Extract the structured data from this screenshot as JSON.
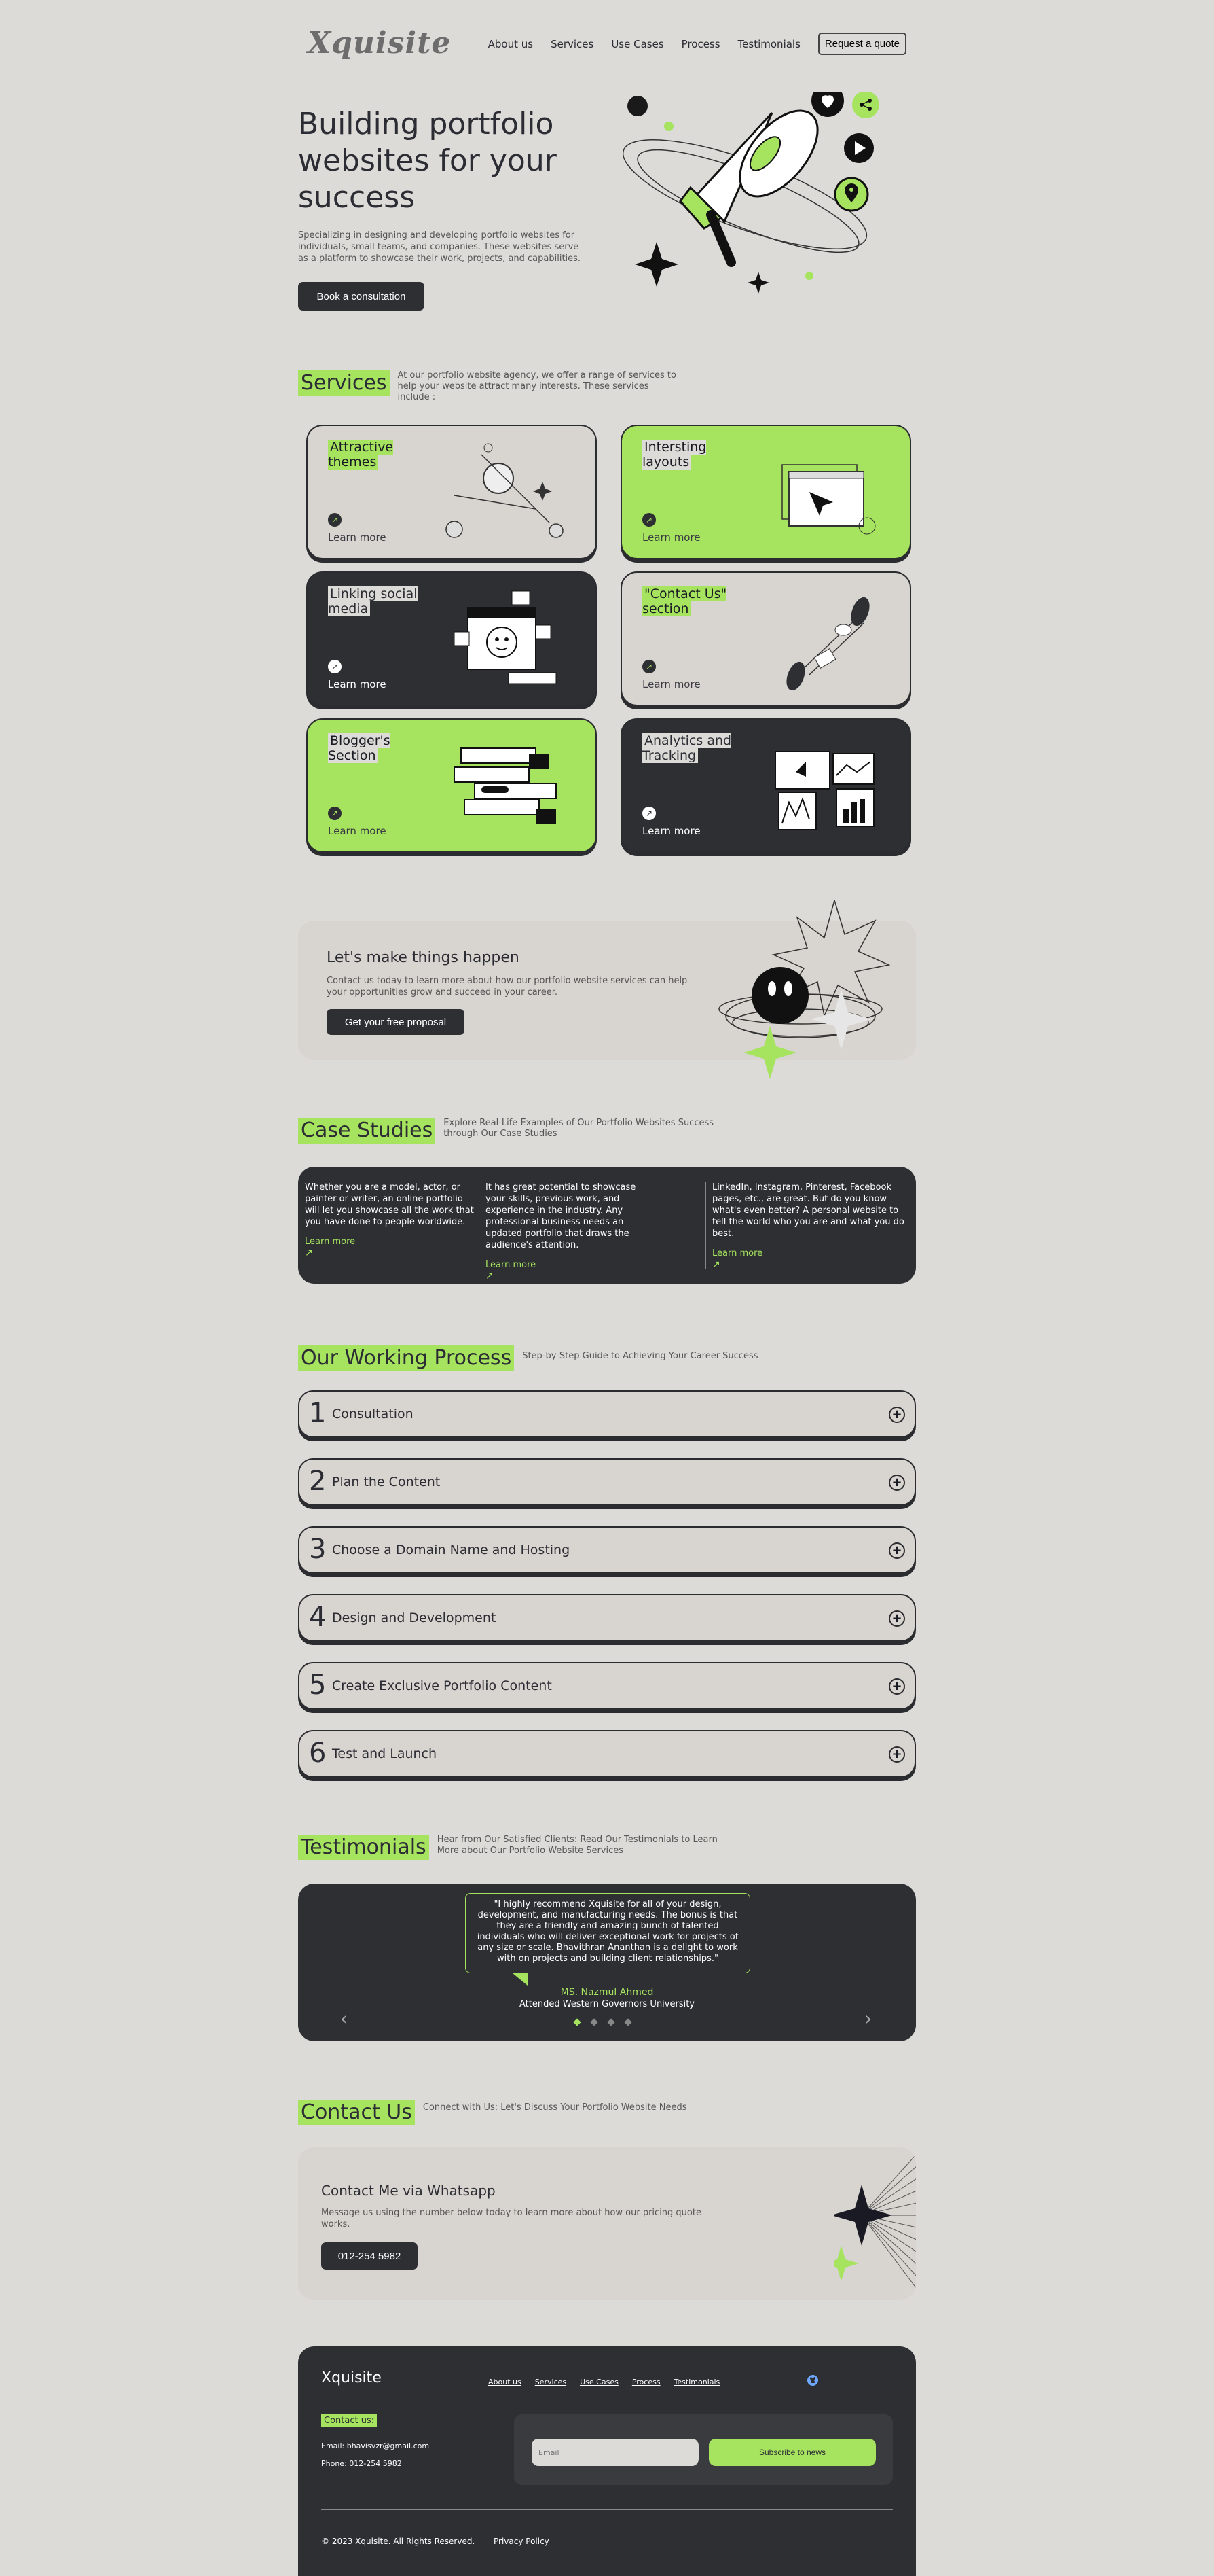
{
  "nav": {
    "logo": "Xquisite",
    "links": [
      "About us",
      "Services",
      "Use Cases",
      "Process",
      "Testimonials"
    ],
    "quote_button": "Request a quote"
  },
  "hero": {
    "title": "Building portfolio websites for your success",
    "description": "Specializing in designing and developing portfolio websites for individuals, small teams, and companies. These websites serve as a platform to showcase their work, projects, and capabilities.",
    "button": "Book a consultation"
  },
  "services": {
    "title": "Services",
    "subtitle": "At our portfolio website agency, we offer a range of services to help your website attract many interests. These services include :",
    "cards": [
      {
        "title": "Attractive themes",
        "link": "Learn more"
      },
      {
        "title": "Intersting layouts",
        "link": "Learn more"
      },
      {
        "title": "Linking social media",
        "link": "Learn more"
      },
      {
        "title": "\"Contact Us\" section",
        "link": "Learn more"
      },
      {
        "title": "Blogger's Section",
        "link": "Learn more"
      },
      {
        "title": "Analytics and Tracking",
        "link": "Learn more"
      }
    ]
  },
  "cta": {
    "title": "Let's make things happen",
    "description": "Contact us today to learn more about how our portfolio website services can help your opportunities grow and succeed in your career.",
    "button": "Get your free proposal"
  },
  "cases": {
    "title": "Case Studies",
    "subtitle": "Explore Real-Life Examples of Our Portfolio Websites Success through Our Case Studies",
    "items": [
      {
        "text": "Whether you are a model, actor, or painter or writer, an online portfolio will let you showcase all the work that you have done to people worldwide.",
        "link": "Learn more"
      },
      {
        "text": "It has great potential to showcase your skills, previous work, and experience in the industry. Any professional business needs an updated portfolio that draws the audience's attention.",
        "link": "Learn more"
      },
      {
        "text": "LinkedIn, Instagram, Pinterest, Facebook pages, etc., are great. But do you know what's even better? A personal website to tell the world who you are and what you do best.",
        "link": "Learn more"
      }
    ]
  },
  "process": {
    "title": "Our Working Process",
    "subtitle": "Step-by-Step Guide to Achieving Your Career Success",
    "steps": [
      {
        "num": "1",
        "title": "Consultation"
      },
      {
        "num": "2",
        "title": "Plan the Content"
      },
      {
        "num": "3",
        "title": "Choose a Domain Name and Hosting"
      },
      {
        "num": "4",
        "title": "Design and Development"
      },
      {
        "num": "5",
        "title": "Create Exclusive Portfolio Content"
      },
      {
        "num": "6",
        "title": "Test and Launch"
      }
    ]
  },
  "testimonials": {
    "title": "Testimonials",
    "subtitle": "Hear from Our Satisfied Clients: Read Our Testimonials to Learn More about Our Portfolio Website Services",
    "quote": "\"I highly recommend Xquisite for all of your design, development, and manufacturing needs. The bonus is that they are a friendly and amazing bunch of talented individuals who will deliver exceptional work for projects of any size or scale. Bhavithran Ananthan is a delight to work with on projects and building client relationships.\"",
    "name": "MS. Nazmul Ahmed",
    "role": "Attended Western Governors University",
    "prev": "‹",
    "next": "›"
  },
  "contact": {
    "title": "Contact Us",
    "subtitle": "Connect with Us: Let's Discuss Your Portfolio Website Needs",
    "card_title": "Contact Me via Whatsapp",
    "card_desc": "Message us using the number below today to learn more about how our pricing quote works.",
    "phone_button": "012-254 5982"
  },
  "footer": {
    "logo": "Xquisite",
    "links": [
      "About us",
      "Services",
      "Use Cases",
      "Process",
      "Testimonials"
    ],
    "contact_label": "Contact us:",
    "email": "Email: bhavisvzr@gmail.com",
    "phone": "Phone: 012-254 5982",
    "email_placeholder": "Email",
    "subscribe": "Subscribe to news",
    "copyright": "© 2023 Xquisite. All Rights Reserved.",
    "privacy": "Privacy Policy"
  },
  "colors": {
    "accent": "#a6e35f",
    "dark": "#2d2f33",
    "background": "#dcdbd7"
  }
}
